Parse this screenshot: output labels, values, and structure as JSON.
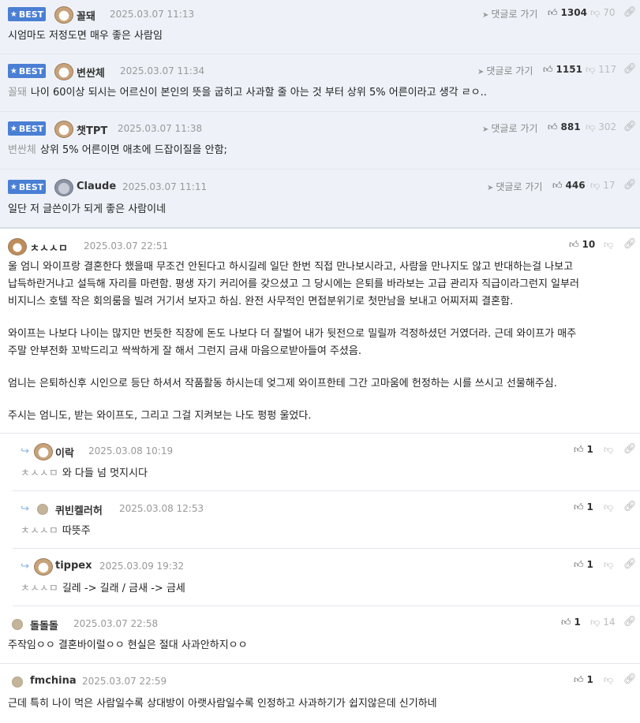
{
  "labels": {
    "best": "BEST",
    "goto": "댓글로 가기"
  },
  "best_comments": [
    {
      "nick": "꼴돼",
      "date": "2025.03.07 11:13",
      "likes": "1304",
      "dislikes": "70",
      "mention": "",
      "text": "시엄마도 저정도면 매우 좋은 사람임",
      "avatar": "dog"
    },
    {
      "nick": "변싼체",
      "date": "2025.03.07 11:34",
      "likes": "1151",
      "dislikes": "117",
      "mention": "꼴돼",
      "text": "나이 60이상 되시는 어르신이 본인의 뜻을 굽히고 사과할 줄 아는 것 부터 상위 5% 어른이라고 생각 ㄹㅇ..",
      "avatar": "dog"
    },
    {
      "nick": "챗TPT",
      "date": "2025.03.07 11:38",
      "likes": "881",
      "dislikes": "302",
      "mention": "변싼체",
      "text": "상위 5% 어른이면 애초에 드잡이질을 안함;",
      "avatar": "dog"
    },
    {
      "nick": "Claude",
      "date": "2025.03.07 11:11",
      "likes": "446",
      "dislikes": "17",
      "mention": "",
      "text": "일단 저 글쓴이가 되게 좋은 사람이네",
      "avatar": "koala"
    }
  ],
  "main_comment": {
    "nick": "ㅊㅅㅅㅁ",
    "date": "2025.03.07 22:51",
    "likes": "10",
    "paragraphs": [
      [
        "울 엄니 와이프랑 결혼한다 했을때 무조건 안된다고 하시길레 일단 한번 직접 만나보시라고, 사람을 만나지도 않고 반대하는걸 나보고",
        "납득하란거냐고 설득해 자리를 마련함. 평생 자기 커리어를 갖으셨고 그 당시에는 은퇴를 바라보는 고급 관리자 직급이라그런지 일부러",
        "비지니스 호텔 작은 회의룸을 빌려 거기서 보자고 하심. 완전 사무적인 면접분위기로 첫만남을 보내고 어찌저찌 결혼함."
      ],
      [
        "와이프는 나보다 나이는 많지만 번듯한 직장에 돈도 나보다 더 잘벌어 내가 뒷전으로 밀릴까 걱정하셨던 거였더라. 근데 와이프가 매주",
        "주말 안부전화 꼬박드리고 싹싹하게 잘 해서 그런지 금새 마음으로받아들여 주셨음."
      ],
      [
        "엄니는 은퇴하신후 시인으로 등단 하셔서 작품활동 하시는데 엊그제 와이프한테 그간 고마움에 헌정하는 시를 쓰시고 선물해주심."
      ],
      [
        "주시는 엄니도, 받는 와이프도, 그리고 그걸 지켜보는 나도 펑펑 울었다."
      ]
    ]
  },
  "replies": [
    {
      "nick": "이락",
      "date": "2025.03.08 10:19",
      "likes": "1",
      "mention": "ㅊㅅㅅㅁ",
      "text": "와 다들 넘 멋지시다",
      "avatar": "dog"
    },
    {
      "nick": "퀴빈켈러허",
      "date": "2025.03.08 12:53",
      "likes": "1",
      "mention": "ㅊㅅㅅㅁ",
      "text": "따뜻주",
      "avatar": "small"
    },
    {
      "nick": "tippex",
      "date": "2025.03.09 19:32",
      "likes": "1",
      "mention": "ㅊㅅㅅㅁ",
      "text": "길레 -> 길래 / 금새 -> 금세",
      "avatar": "dog"
    }
  ],
  "other_comments": [
    {
      "nick": "돌돌돌",
      "date": "2025.03.07 22:58",
      "likes": "1",
      "dislikes": "14",
      "text": "주작임ㅇㅇ 결혼바이럴ㅇㅇ 현실은 절대 사과안하지ㅇㅇ"
    },
    {
      "nick": "fmchina",
      "date": "2025.03.07 22:59",
      "likes": "1",
      "dislikes": "",
      "text": "근데 특히 나이 먹은 사람일수록 상대방이 아랫사람일수록 인정하고 사과하기가 쉽지않은데 신기하네"
    }
  ]
}
